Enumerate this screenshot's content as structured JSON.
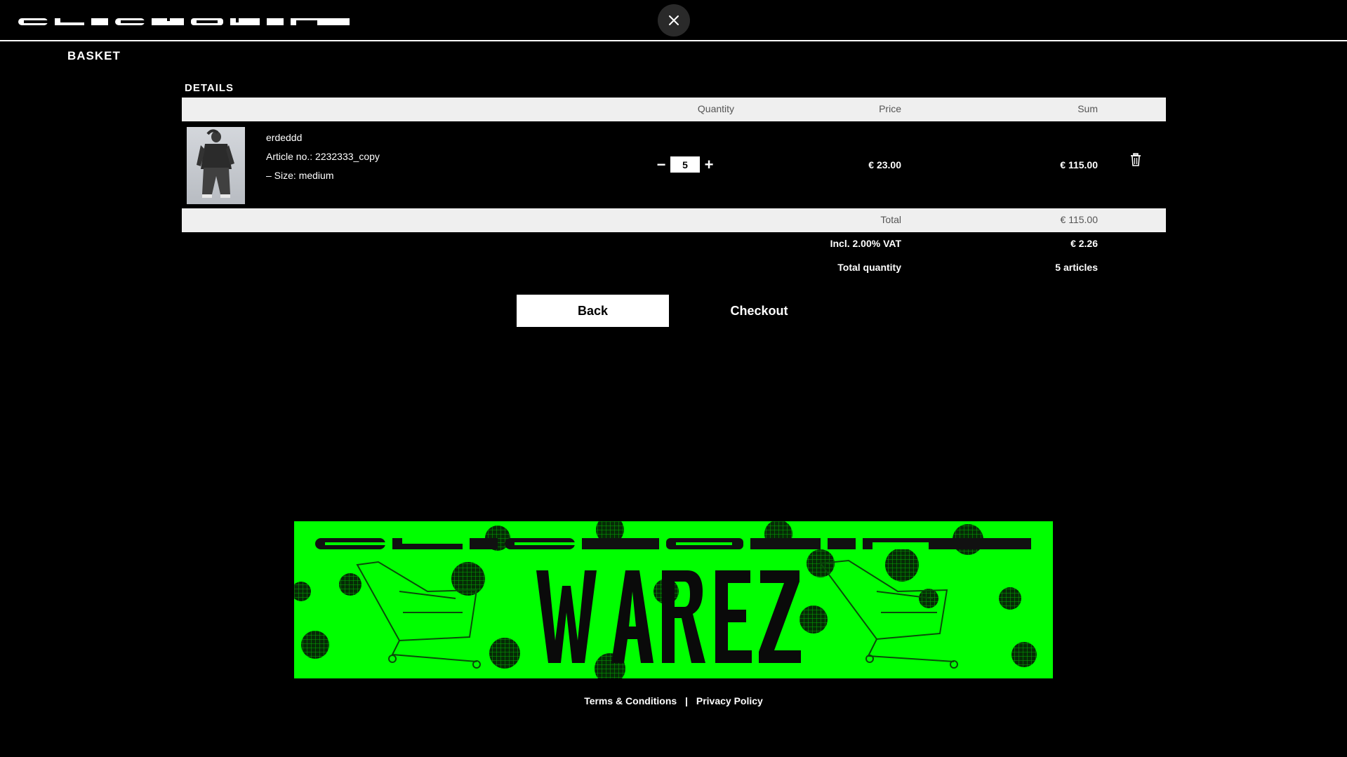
{
  "header": {
    "logo_text": "CLICKB4IT",
    "close_icon": "close-icon"
  },
  "page_title": "BASKET",
  "basket": {
    "section_title": "DETAILS",
    "columns": {
      "quantity": "Quantity",
      "price": "Price",
      "sum": "Sum"
    },
    "items": [
      {
        "name": "erdeddd",
        "article": "Article no.: 2232333_copy",
        "size": "– Size: medium",
        "quantity": "5",
        "price": "€ 23.00",
        "sum": "€ 115.00"
      }
    ],
    "total_label": "Total",
    "total_value": "€ 115.00",
    "vat_label": "Incl. 2.00% VAT",
    "vat_value": "€ 2.26",
    "qty_label": "Total quantity",
    "qty_value": "5 articles"
  },
  "actions": {
    "back": "Back",
    "checkout": "Checkout"
  },
  "banner": {
    "logo_text": "CLICKB4IT",
    "word": "WAREZ"
  },
  "footer": {
    "terms": "Terms & Conditions",
    "separator": "|",
    "privacy": "Privacy Policy"
  },
  "colors": {
    "accent": "#00ff00",
    "background": "#000000",
    "header_bar": "#efefef"
  }
}
